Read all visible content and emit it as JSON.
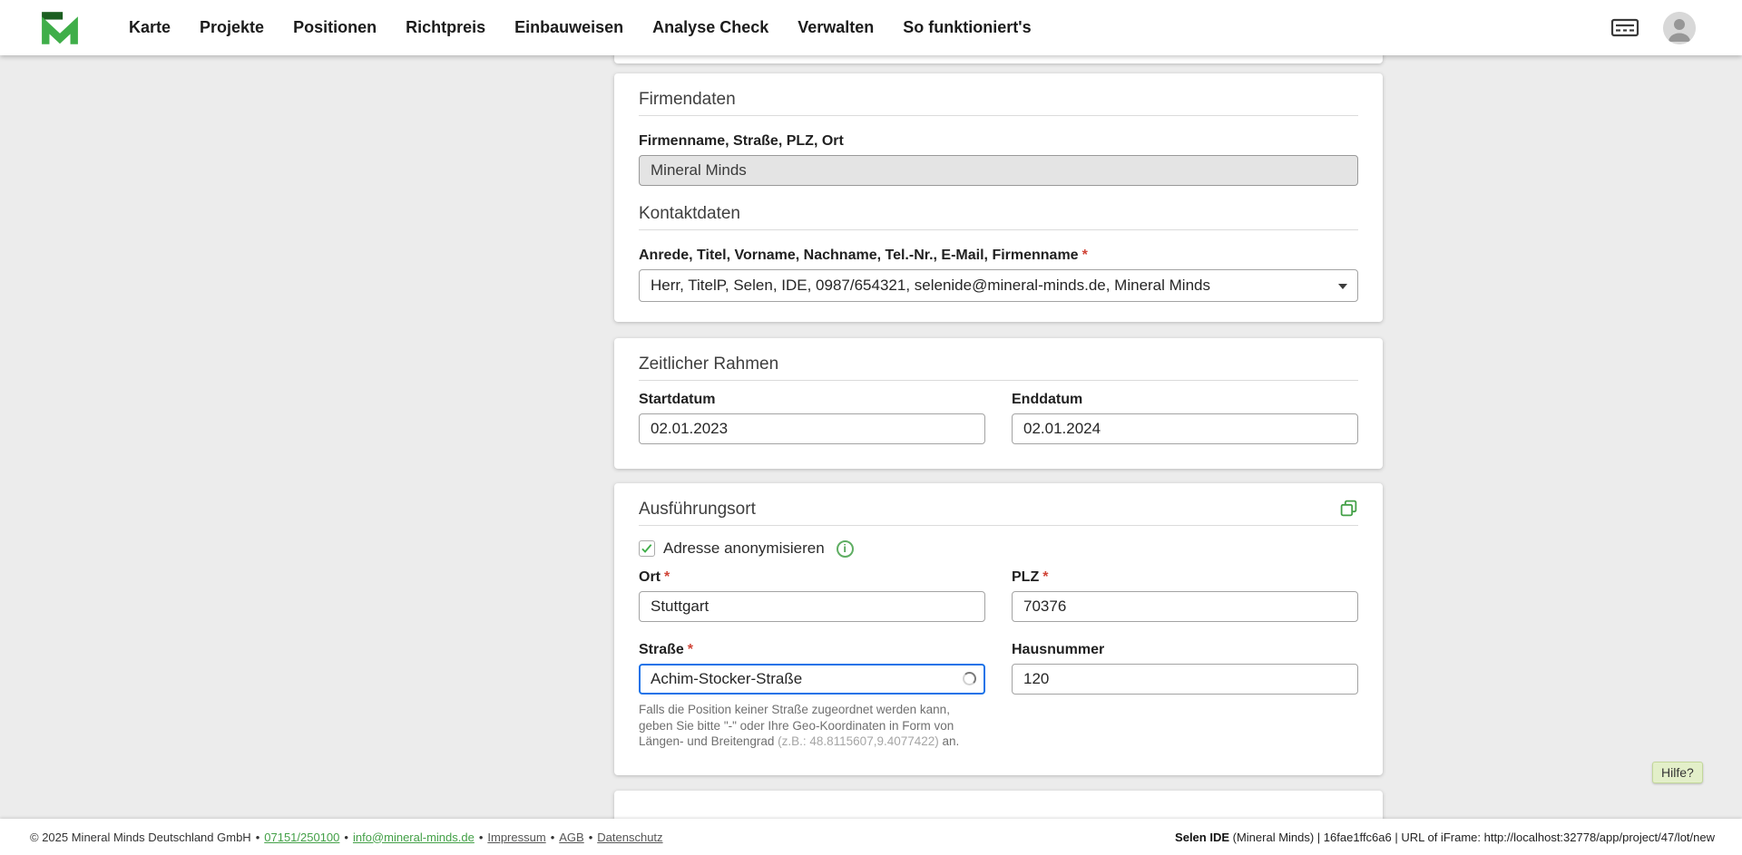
{
  "nav": {
    "items": [
      {
        "label": "Karte"
      },
      {
        "label": "Projekte"
      },
      {
        "label": "Positionen"
      },
      {
        "label": "Richtpreis"
      },
      {
        "label": "Einbauweisen"
      },
      {
        "label": "Analyse Check"
      },
      {
        "label": "Verwalten"
      },
      {
        "label": "So funktioniert's"
      }
    ]
  },
  "required_mark": "*",
  "icons": {
    "info_glyph": "i"
  },
  "cards": {
    "firmendaten": {
      "title": "Firmendaten",
      "company_label": "Firmenname, Straße, PLZ, Ort",
      "company_value": "Mineral Minds",
      "kontakt_title": "Kontaktdaten",
      "kontakt_label": "Anrede, Titel, Vorname, Nachname, Tel.-Nr., E-Mail, Firmenname",
      "kontakt_value": "Herr, TitelP, Selen, IDE, 0987/654321, selenide@mineral-minds.de, Mineral Minds"
    },
    "zeitlicher_rahmen": {
      "title": "Zeitlicher Rahmen",
      "startdatum_label": "Startdatum",
      "startdatum_value": "02.01.2023",
      "enddatum_label": "Enddatum",
      "enddatum_value": "02.01.2024"
    },
    "ausfuehrungsort": {
      "title": "Ausführungsort",
      "anonymisieren_label": "Adresse anonymisieren",
      "anonymisieren_checked": true,
      "ort_label": "Ort",
      "ort_value": "Stuttgart",
      "plz_label": "PLZ",
      "plz_value": "70376",
      "strasse_label": "Straße",
      "strasse_value": "Achim-Stocker-Straße",
      "hausnummer_label": "Hausnummer",
      "hausnummer_value": "120",
      "helper_text_start": "Falls die Position keiner Straße zugeordnet werden kann, geben Sie bitte \"-\" oder Ihre Geo-Koordinaten in Form von Längen- und Breitengrad ",
      "helper_text_coords": "(z.B.: 48.8115607,9.4077422)",
      "helper_text_end": " an."
    }
  },
  "help_button_label": "Hilfe?",
  "footer": {
    "copyright": "© 2025 Mineral Minds Deutschland GmbH",
    "separator": "•",
    "phone_link": "07151/250100",
    "email_link": "info@mineral-minds.de",
    "impressum_link": "Impressum",
    "agb_link": "AGB",
    "datenschutz_link": "Datenschutz",
    "app_info_bold": "Selen IDE",
    "app_info_rest": " (Mineral Minds) | 16fae1ffc6a6 | URL of iFrame: http://localhost:32778/app/project/47/lot/new"
  },
  "colors": {
    "accent_green": "#43a047",
    "dark_green": "#1b5e20",
    "focus_blue": "#1a73e8",
    "required_red": "#d04437",
    "page_background": "#ececec"
  }
}
